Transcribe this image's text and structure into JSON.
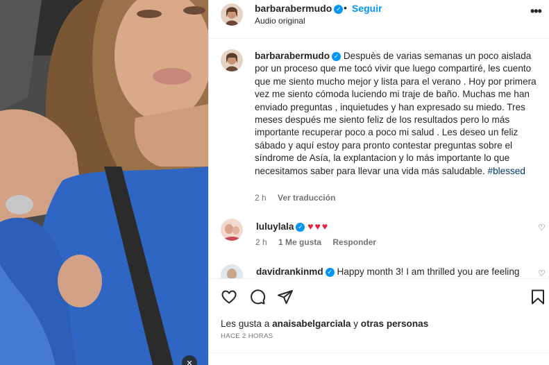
{
  "colors": {
    "accent": "#0095f6",
    "heart": "#ed1d3c",
    "secondary_text": "#737373",
    "hashtag": "#00376b"
  },
  "video": {
    "mute_icon": "speaker-muted-icon"
  },
  "header": {
    "username": "barbarabermudo",
    "separator": "•",
    "follow_label": "Seguir",
    "audio_label": "Audio original",
    "more_icon": "more-horizontal-icon"
  },
  "caption": {
    "username": "barbarabermudo",
    "text": "Despuès de varias semanas un poco aislada por un proceso que me tocó vivir que luego compartiré, les cuento que me siento mucho mejor y lista para el verano . Hoy por primera vez me siento cómoda luciendo mi traje de baño. Muchas me han enviado preguntas , inquietudes y han expresado su miedo. Tres meses después me siento feliz de los resultados pero lo más importante recuperar poco a poco mi salud . Les deseo un feliz sábado y aquí estoy para pronto contestar preguntas sobre el síndrome de Asía, la explantacion y lo más importante lo que necesitamos saber para llevar una vida más saludable.",
    "hashtag": "#blessed",
    "time": "2 h",
    "translate_label": "Ver traducción"
  },
  "comments": [
    {
      "username": "luluylala",
      "text": "♥♥♥",
      "time": "2 h",
      "likes": "1 Me gusta",
      "reply_label": "Responder"
    },
    {
      "username": "davidrankinmd",
      "text": "Happy month 3! I am thrilled you are feeling"
    }
  ],
  "actions": {
    "like_icon": "heart-icon",
    "comment_icon": "comment-icon",
    "share_icon": "share-icon",
    "save_icon": "bookmark-icon"
  },
  "likes": {
    "prefix": "Les gusta a",
    "user": "anaisabelgarciala",
    "middle": "y",
    "others": "otras personas"
  },
  "timestamp": "HACE 2 HORAS"
}
